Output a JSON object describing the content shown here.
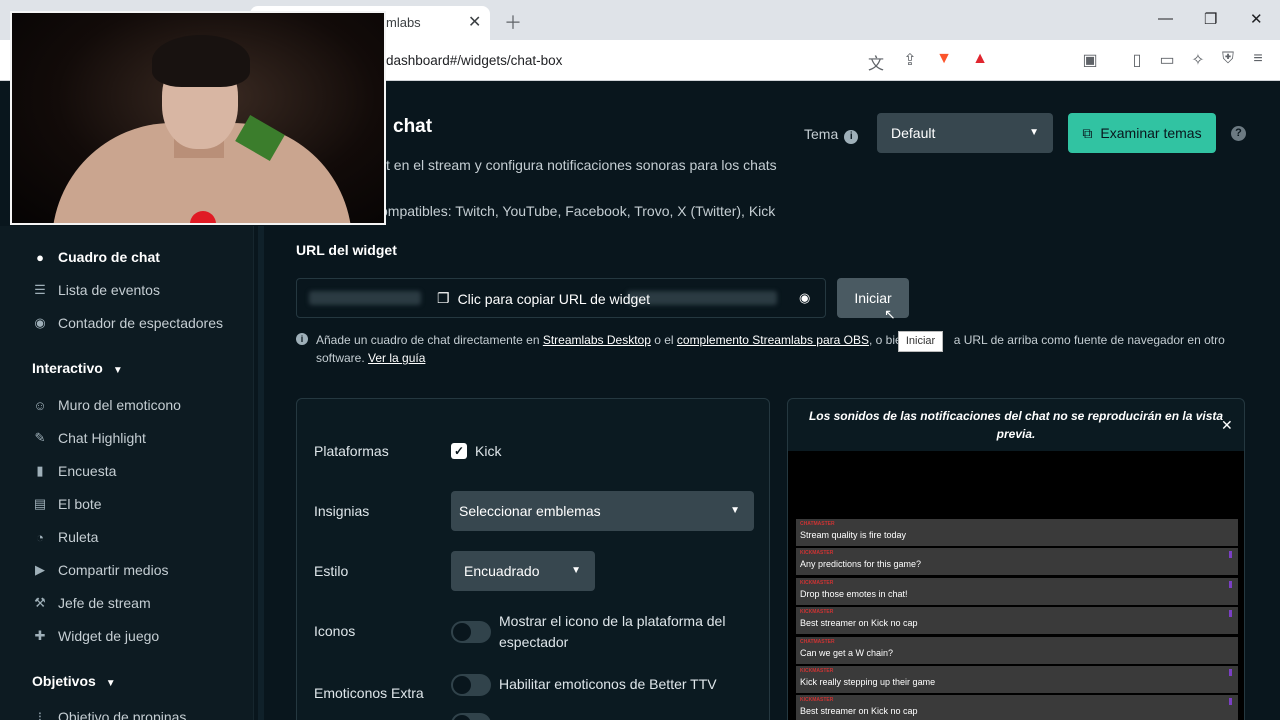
{
  "browser": {
    "tab_title": "mlabs",
    "url": "dashboard#/widgets/chat-box"
  },
  "sidebar": {
    "items_top": [
      {
        "label": "Cuadro de chat",
        "icon": "chat-bubble-icon",
        "active": true
      },
      {
        "label": "Lista de eventos",
        "icon": "list-icon"
      },
      {
        "label": "Contador de espectadores",
        "icon": "eye-icon"
      }
    ],
    "section_interactivo": "Interactivo",
    "items_interactivo": [
      {
        "label": "Muro del emoticono",
        "icon": "smiley-icon"
      },
      {
        "label": "Chat Highlight",
        "icon": "highlight-pen-icon"
      },
      {
        "label": "Encuesta",
        "icon": "bar-chart-icon"
      },
      {
        "label": "El bote",
        "icon": "jar-icon"
      },
      {
        "label": "Ruleta",
        "icon": "pie-wheel-icon"
      },
      {
        "label": "Compartir medios",
        "icon": "play-icon"
      },
      {
        "label": "Jefe de stream",
        "icon": "hammer-icon"
      },
      {
        "label": "Widget de juego",
        "icon": "gamepad-icon"
      }
    ],
    "section_objetivos": "Objetivos",
    "item_objetivos_partial": "Objetivo de propinas"
  },
  "header": {
    "title": "chat",
    "description": "t en el stream y configura notificaciones sonoras para los chats",
    "compat": "ompatibles: Twitch, YouTube, Facebook, Trovo, X (Twitter), Kick",
    "tema_label": "Tema",
    "theme_value": "Default",
    "explore_label": "Examinar temas"
  },
  "widget_url": {
    "label": "URL del widget",
    "copy_label": "Clic para copiar URL de widget",
    "start_label": "Iniciar",
    "tooltip": "Iniciar",
    "note_pre": "Añade un cuadro de chat directamente en ",
    "note_link1": "Streamlabs Desktop",
    "note_mid": " o el ",
    "note_link2": "complemento Streamlabs para OBS",
    "note_post": ", o bie",
    "note_post2": "a URL de arriba como fuente de navegador en otro software. ",
    "note_link3": "Ver la guía"
  },
  "settings": {
    "platforms_label": "Plataformas",
    "platform_kick": "Kick",
    "badges_label": "Insignias",
    "badges_value": "Seleccionar emblemas",
    "style_label": "Estilo",
    "style_value": "Encuadrado",
    "icons_label": "Iconos",
    "icons_toggle": "Mostrar el icono de la plataforma del espectador",
    "emotes_label": "Emoticonos Extra",
    "emotes_toggle": "Habilitar emoticonos de Better TTV"
  },
  "preview": {
    "note": "Los sonidos de las notificaciones del chat no se reproducirán en la vista previa.",
    "messages": [
      {
        "name": "CHATMASTER",
        "text": "Stream quality is fire today"
      },
      {
        "name": "KICKMASTER",
        "text": "Any predictions for this game?"
      },
      {
        "name": "KICKMASTER",
        "text": "Drop those emotes in chat!"
      },
      {
        "name": "KICKMASTER",
        "text": "Best streamer on Kick no cap"
      },
      {
        "name": "CHATMASTER",
        "text": "Can we get a W chain?"
      },
      {
        "name": "KICKMASTER",
        "text": "Kick really stepping up their game"
      },
      {
        "name": "KICKMASTER",
        "text": "Best streamer on Kick no cap"
      }
    ]
  },
  "colors": {
    "accent": "#31c3a2",
    "background": "#09161d"
  }
}
